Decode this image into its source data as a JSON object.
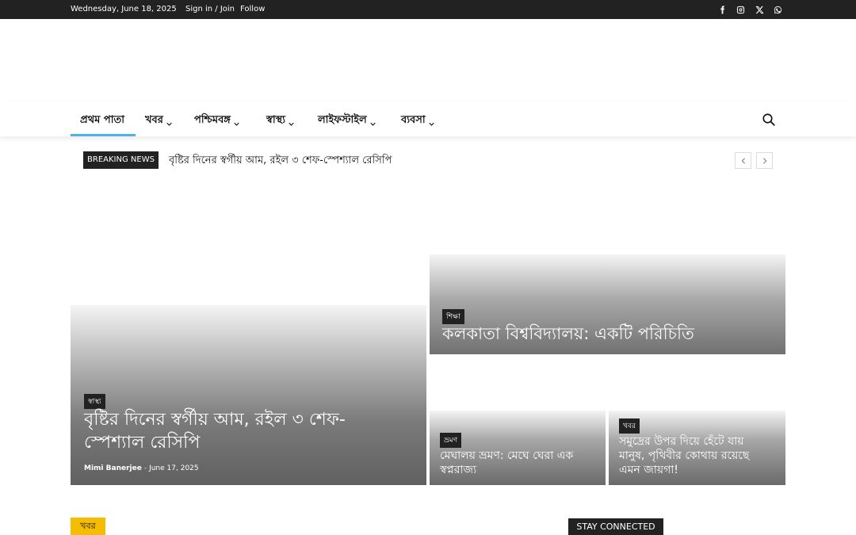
{
  "topbar": {
    "date": "Wednesday, June 18, 2025",
    "signin": "Sign in / Join",
    "follow": "Follow",
    "social": [
      "facebook-icon",
      "instagram-icon",
      "x-icon",
      "whatsapp-icon"
    ]
  },
  "nav": {
    "items": [
      {
        "label": "প্রথম পাতা",
        "dropdown": false
      },
      {
        "label": "খবর",
        "dropdown": true
      },
      {
        "label": "পশ্চিমবঙ্গ",
        "dropdown": true
      },
      {
        "label": "স্বাস্থ্য",
        "dropdown": true
      },
      {
        "label": "লাইফস্টাইল",
        "dropdown": true
      },
      {
        "label": "ব্যবসা",
        "dropdown": true
      }
    ],
    "active_color": "#4db2ec"
  },
  "breaking": {
    "label": "BREAKING NEWS",
    "headline": "বৃষ্টির দিনের স্বর্গীয় আম, রইল ৩ শেফ-স্পেশ্যাল রেসিপি"
  },
  "hero": {
    "big": {
      "category": "স্বাস্থ্য",
      "title_line1": "বৃষ্টির দিনের স্বর্গীয় আম, রইল ৩ শেফ-",
      "title_line2": "স্পেশ্যাল রেসিপি",
      "author": "Mimi Banerjee",
      "separator": "-",
      "date": "June 17, 2025"
    },
    "top": {
      "category": "শিক্ষা",
      "title": "কলকাতা বিশ্ববিদ্যালয়: একটি পরিচিতি"
    },
    "small1": {
      "category": "ভ্রমণ",
      "title_line1": "মেঘালয় ভ্রমণ: মেঘে ঘেরা এক",
      "title_line2": "স্বপ্নরাজ্য"
    },
    "small2": {
      "category": "খবর",
      "title_line1": "সমুদ্রের উপর দিয়ে হেঁটে যায়",
      "title_line2": "মানুষ, পৃথিবীর কোথায় রয়েছে",
      "title_line3": "এমন জায়গা!"
    }
  },
  "bottom": {
    "section_tag": "খবর",
    "section_tag_color": "#f5bd00",
    "stay_connected": "STAY CONNECTED"
  }
}
